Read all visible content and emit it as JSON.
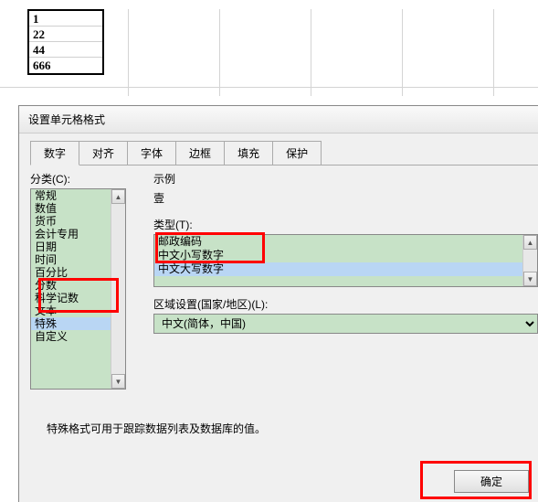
{
  "sheet": {
    "cells": [
      "1",
      "22",
      "44",
      "666"
    ]
  },
  "dialog": {
    "title": "设置单元格格式",
    "tabs": [
      {
        "label": "数字"
      },
      {
        "label": "对齐"
      },
      {
        "label": "字体"
      },
      {
        "label": "边框"
      },
      {
        "label": "填充"
      },
      {
        "label": "保护"
      }
    ],
    "category_label": "分类(C):",
    "categories": [
      "常规",
      "数值",
      "货币",
      "会计专用",
      "日期",
      "时间",
      "百分比",
      "分数",
      "科学记数",
      "文本",
      "特殊",
      "自定义"
    ],
    "sample_label": "示例",
    "sample_value": "壹",
    "type_label": "类型(T):",
    "types": [
      "邮政编码",
      "中文小写数字",
      "中文大写数字"
    ],
    "locale_label": "区域设置(国家/地区)(L):",
    "locale_value": "中文(简体，中国)",
    "help_text": "特殊格式可用于跟踪数据列表及数据库的值。",
    "ok_button": "确定"
  }
}
